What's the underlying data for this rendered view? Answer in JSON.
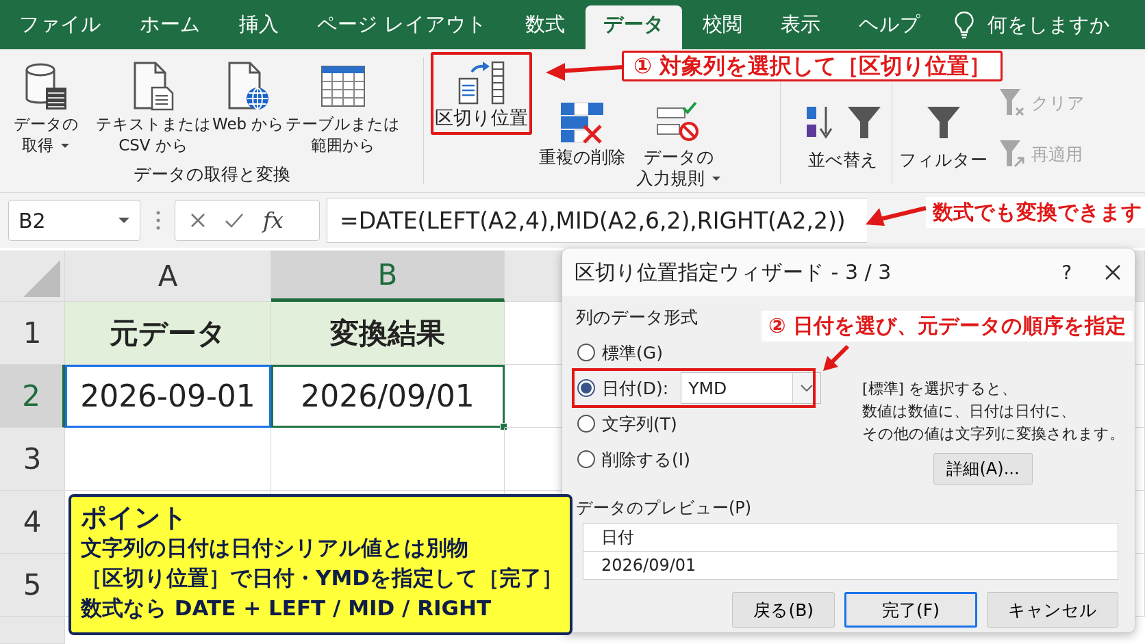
{
  "tabs": [
    {
      "label": "ファイル",
      "selected": false
    },
    {
      "label": "ホーム",
      "selected": false
    },
    {
      "label": "挿入",
      "selected": false
    },
    {
      "label": "ページ レイアウト",
      "selected": false
    },
    {
      "label": "数式",
      "selected": false
    },
    {
      "label": "データ",
      "selected": true
    },
    {
      "label": "校閲",
      "selected": false
    },
    {
      "label": "表示",
      "selected": false
    },
    {
      "label": "ヘルプ",
      "selected": false
    }
  ],
  "tell_me": {
    "placeholder": "何をしますか"
  },
  "ribbon": {
    "get_transform": {
      "buttons": [
        {
          "kind": "database",
          "lines": [
            "データの",
            "取得"
          ],
          "has_menu": true
        },
        {
          "kind": "text-file",
          "lines": [
            "テキストまたは",
            "CSV から"
          ],
          "has_menu": false
        },
        {
          "kind": "web-file",
          "lines": [
            "Web から"
          ],
          "has_menu": false
        },
        {
          "kind": "table",
          "lines": [
            "テーブルまたは",
            "範囲から"
          ],
          "has_menu": false
        }
      ],
      "group_label": "データの取得と変換"
    },
    "data_tools": [
      {
        "kind": "text-to-columns",
        "lines": [
          "区切り位置"
        ],
        "has_menu": false,
        "highlighted": true
      },
      {
        "kind": "remove-duplicates",
        "lines": [
          "重複の削除"
        ],
        "has_menu": false,
        "highlighted": false
      },
      {
        "kind": "validation",
        "lines": [
          "データの",
          "入力規則"
        ],
        "has_menu": true,
        "highlighted": false
      }
    ],
    "sort": {
      "label": "並べ替え"
    },
    "filter": {
      "label": "フィルター"
    },
    "filter_options": [
      {
        "kind": "clear",
        "label": "クリア",
        "disabled": true
      },
      {
        "kind": "reapply",
        "label": "再適用",
        "disabled": true
      }
    ]
  },
  "formula_bar": {
    "name_box": "B2",
    "fx": "fx",
    "formula": "=DATE(LEFT(A2,4),MID(A2,6,2),RIGHT(A2,2))"
  },
  "sheet": {
    "columns": [
      {
        "label": "A",
        "selected": false
      },
      {
        "label": "B",
        "selected": true
      }
    ],
    "rows": [
      {
        "label": "1",
        "selected": false,
        "cells": [
          {
            "text": "元データ",
            "kind": "header",
            "referenced": false,
            "active": false
          },
          {
            "text": "変換結果",
            "kind": "header",
            "referenced": false,
            "active": false
          }
        ]
      },
      {
        "label": "2",
        "selected": true,
        "cells": [
          {
            "text": "2026-09-01",
            "kind": "value",
            "referenced": true,
            "active": false
          },
          {
            "text": "2026/09/01",
            "kind": "value",
            "referenced": false,
            "active": true
          }
        ]
      },
      {
        "label": "3",
        "selected": false
      },
      {
        "label": "4",
        "selected": false
      },
      {
        "label": "5",
        "selected": false
      }
    ]
  },
  "dialog": {
    "title": "区切り位置指定ウィザード - 3 / 3",
    "help": "?",
    "format_legend": "列のデータ形式",
    "formats": [
      {
        "label": "標準(G)",
        "selected": false,
        "highlighted": false
      },
      {
        "label": "日付(D):",
        "selected": true,
        "highlighted": true,
        "value": "YMD"
      },
      {
        "label": "文字列(T)",
        "selected": false,
        "highlighted": false
      },
      {
        "label": "削除する(I)",
        "selected": false,
        "highlighted": false
      }
    ],
    "description": [
      "[標準] を選択すると、",
      "数値は数値に、日付は日付に、",
      "その他の値は文字列に変換されます。"
    ],
    "advanced_button": "詳細(A)...",
    "preview_legend": "データのプレビュー(P)",
    "preview_header": "日付",
    "preview_value": "2026/09/01",
    "buttons": [
      {
        "label": "戻る(B)",
        "default": false
      },
      {
        "label": "完了(F)",
        "default": true
      },
      {
        "label": "キャンセル",
        "default": false
      }
    ]
  },
  "annotations": [
    {
      "kind": "ribbon",
      "text": "① 対象列を選択して［区切り位置］"
    },
    {
      "kind": "formula",
      "text": "数式でも変換できます"
    },
    {
      "kind": "dialog",
      "text": "② 日付を選び、元データの順序を指定"
    }
  ],
  "note": {
    "title": "ポイント",
    "lines": [
      "文字列の日付は日付シリアル値とは別物",
      "［区切り位置］で日付・YMDを指定して［完了］",
      "数式なら DATE + LEFT / MID / RIGHT"
    ]
  }
}
